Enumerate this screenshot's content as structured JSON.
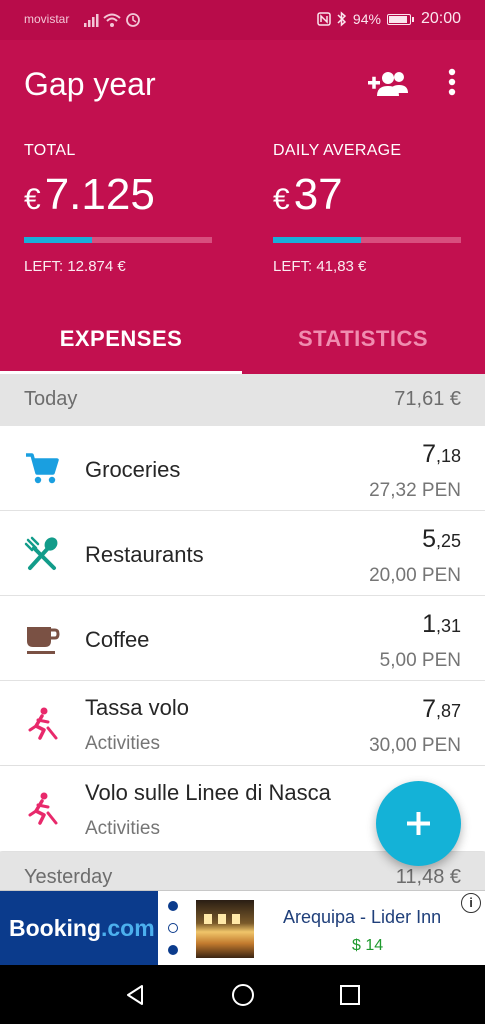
{
  "status_bar": {
    "carrier": "movistar",
    "battery": "94%",
    "time": "20:00"
  },
  "header": {
    "title": "Gap year",
    "total": {
      "label": "TOTAL",
      "currency": "€",
      "value": "7.125",
      "spent_fraction": 0.36,
      "left": "LEFT: 12.874 €"
    },
    "daily_average": {
      "label": "DAILY AVERAGE",
      "currency": "€",
      "value": "37",
      "spent_fraction": 0.47,
      "left": "LEFT: 41,83 €"
    }
  },
  "tabs": [
    {
      "label": "EXPENSES",
      "active": true
    },
    {
      "label": "STATISTICS",
      "active": false
    }
  ],
  "groups": [
    {
      "label": "Today",
      "total": "71,61 €",
      "items": [
        {
          "icon": "cart-icon",
          "name": "Groceries",
          "subtitle": "",
          "amount_int": "7",
          "amount_dec": ",18",
          "original": "27,32 PEN"
        },
        {
          "icon": "utensils-icon",
          "name": "Restaurants",
          "subtitle": "",
          "amount_int": "5",
          "amount_dec": ",25",
          "original": "20,00 PEN"
        },
        {
          "icon": "coffee-cup-icon",
          "name": "Coffee",
          "subtitle": "",
          "amount_int": "1",
          "amount_dec": ",31",
          "original": "5,00 PEN"
        },
        {
          "icon": "activity-skate-icon",
          "name": "Tassa volo",
          "subtitle": "Activities",
          "amount_int": "7",
          "amount_dec": ",87",
          "original": "30,00 PEN"
        },
        {
          "icon": "activity-skate-icon",
          "name": "Volo sulle Linee di Nasca",
          "subtitle": "Activities",
          "amount_int": "",
          "amount_dec": "",
          "original": ""
        }
      ]
    },
    {
      "label": "Yesterday",
      "total": "11,48 €",
      "items": []
    }
  ],
  "ad": {
    "brand": "Booking",
    "brand_suffix": ".com",
    "hotel": "Arequipa - Lider Inn",
    "price": "$ 14",
    "info": "i"
  },
  "colors": {
    "primary": "#c2104f",
    "status_bar": "#b80c4a",
    "accent": "#14b2d7",
    "cart": "#1a9fe0",
    "restaurant": "#129c8a",
    "coffee": "#7a5144",
    "activity": "#e8296b",
    "booking": "#0b3b8c"
  }
}
